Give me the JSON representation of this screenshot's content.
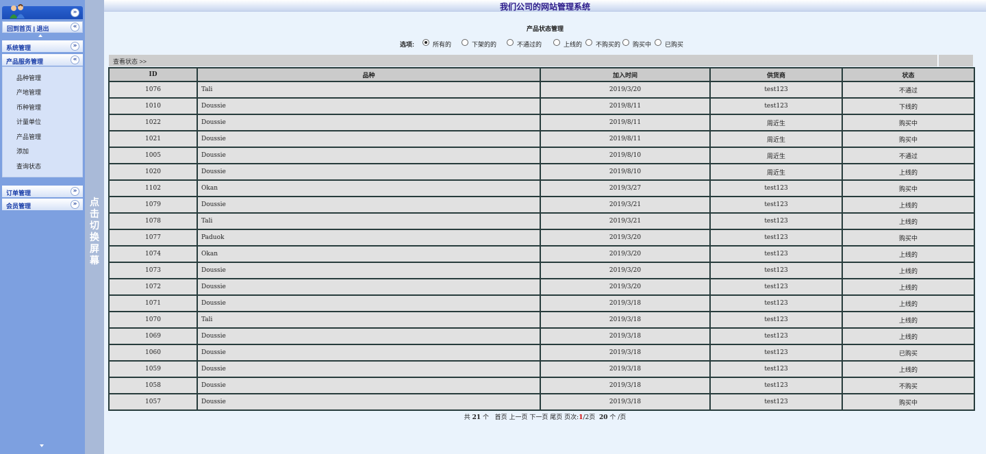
{
  "app": {
    "title": "我们公司的网站管理系统"
  },
  "sidebar": {
    "home_links": "回到首页 | 退出",
    "sections": [
      {
        "label": "系统管理",
        "expanded": false
      },
      {
        "label": "产品服务管理",
        "expanded": true
      },
      {
        "label": "订单管理",
        "expanded": false
      },
      {
        "label": "会员管理",
        "expanded": false
      }
    ],
    "product_items": [
      "品种管理",
      "产地管理",
      "币种管理",
      "计量单位",
      "产品管理",
      "添加",
      "查询状态"
    ]
  },
  "toggle": {
    "text": "点击切换屏幕"
  },
  "main": {
    "page_title": "产品状态管理",
    "filter_label": "选项:",
    "filter_options": [
      {
        "label": "所有的",
        "checked": true
      },
      {
        "label": "下架的的",
        "checked": false
      },
      {
        "label": "不通过的",
        "checked": false
      },
      {
        "label": "上线的",
        "checked": false
      },
      {
        "label": "不购买的",
        "checked": false
      },
      {
        "label": "购买中",
        "checked": false
      },
      {
        "label": "已购买",
        "checked": false
      }
    ],
    "breadcrumb": "查看状态 >>",
    "table": {
      "columns": [
        "ID",
        "品种",
        "加入时间",
        "供货商",
        "状态"
      ],
      "rows": [
        [
          "1076",
          "Tali",
          "2019/3/20",
          "test123",
          "不通过"
        ],
        [
          "1010",
          "Doussie",
          "2019/8/11",
          "test123",
          "下线的"
        ],
        [
          "1022",
          "Doussie",
          "2019/8/11",
          "周近生",
          "购买中"
        ],
        [
          "1021",
          "Doussie",
          "2019/8/11",
          "周近生",
          "购买中"
        ],
        [
          "1005",
          "Doussie",
          "2019/8/10",
          "周近生",
          "不通过"
        ],
        [
          "1020",
          "Doussie",
          "2019/8/10",
          "周近生",
          "上线的"
        ],
        [
          "1102",
          "Okan",
          "2019/3/27",
          "test123",
          "购买中"
        ],
        [
          "1079",
          "Doussie",
          "2019/3/21",
          "test123",
          "上线的"
        ],
        [
          "1078",
          "Tali",
          "2019/3/21",
          "test123",
          "上线的"
        ],
        [
          "1077",
          "Paduok",
          "2019/3/20",
          "test123",
          "购买中"
        ],
        [
          "1074",
          "Okan",
          "2019/3/20",
          "test123",
          "上线的"
        ],
        [
          "1073",
          "Doussie",
          "2019/3/20",
          "test123",
          "上线的"
        ],
        [
          "1072",
          "Doussie",
          "2019/3/20",
          "test123",
          "上线的"
        ],
        [
          "1071",
          "Doussie",
          "2019/3/18",
          "test123",
          "上线的"
        ],
        [
          "1070",
          "Tali",
          "2019/3/18",
          "test123",
          "上线的"
        ],
        [
          "1069",
          "Doussie",
          "2019/3/18",
          "test123",
          "上线的"
        ],
        [
          "1060",
          "Doussie",
          "2019/3/18",
          "test123",
          "已购买"
        ],
        [
          "1059",
          "Doussie",
          "2019/3/18",
          "test123",
          "上线的"
        ],
        [
          "1058",
          "Doussie",
          "2019/3/18",
          "test123",
          "不购买"
        ],
        [
          "1057",
          "Doussie",
          "2019/3/18",
          "test123",
          "购买中"
        ]
      ]
    },
    "pager": {
      "prefix": "共 ",
      "total": "21",
      "after_total": " 个   ",
      "first": "首页",
      "prev": "上一页",
      "next": "下一页",
      "last": "尾页",
      "page_label": " 页次:",
      "current_page": "1",
      "page_sep": "/2页  ",
      "per_page": "20",
      "per_page_suffix": " 个 /页"
    }
  }
}
